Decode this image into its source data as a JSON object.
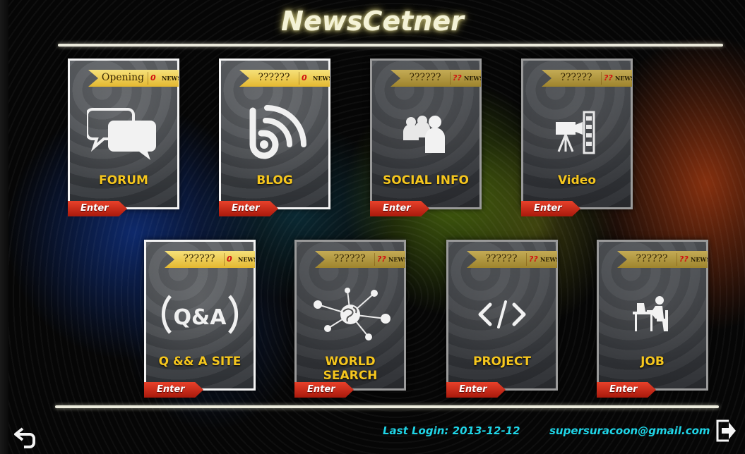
{
  "app": {
    "title": "NewsCetner"
  },
  "cards": [
    {
      "label": "FORUM",
      "ribbon_label": "Opening",
      "count": "0",
      "news": "NEWS",
      "icon": "chat-bubbles-icon",
      "enter": "Enter",
      "active": true
    },
    {
      "label": "BLOG",
      "ribbon_label": "??????",
      "count": "0",
      "news": "NEWS",
      "icon": "blog-rss-icon",
      "enter": "Enter",
      "active": true
    },
    {
      "label": "SOCIAL INFO",
      "ribbon_label": "??????",
      "count": "??",
      "news": "NEWS",
      "icon": "people-group-icon",
      "enter": "Enter",
      "active": false
    },
    {
      "label": "Video",
      "ribbon_label": "??????",
      "count": "??",
      "news": "NEWS",
      "icon": "video-camera-icon",
      "enter": "Enter",
      "active": false
    },
    {
      "label": "Q && A SITE",
      "ribbon_label": "??????",
      "count": "0",
      "news": "NEWS",
      "icon": "qa-icon",
      "enter": "Enter",
      "active": true
    },
    {
      "label": "WORLD SEARCH",
      "ribbon_label": "??????",
      "count": "??",
      "news": "NEWS",
      "icon": "world-network-icon",
      "enter": "Enter",
      "active": false
    },
    {
      "label": "PROJECT",
      "ribbon_label": "??????",
      "count": "??",
      "news": "NEWS",
      "icon": "code-icon",
      "enter": "Enter",
      "active": false
    },
    {
      "label": "JOB",
      "ribbon_label": "??????",
      "count": "??",
      "news": "NEWS",
      "icon": "worker-desk-icon",
      "enter": "Enter",
      "active": false
    }
  ],
  "footer": {
    "last_login": "Last Login: 2013-12-12",
    "email": "supersuracoon@gmail.com",
    "back_icon": "back-arrow-icon",
    "logout_icon": "logout-icon"
  },
  "colors": {
    "title": "#f4f2d6",
    "card_label": "#f5c61e",
    "enter_button": "#d0301a",
    "footer_text": "#1fd4e6",
    "ribbon": "#eccb4f"
  }
}
